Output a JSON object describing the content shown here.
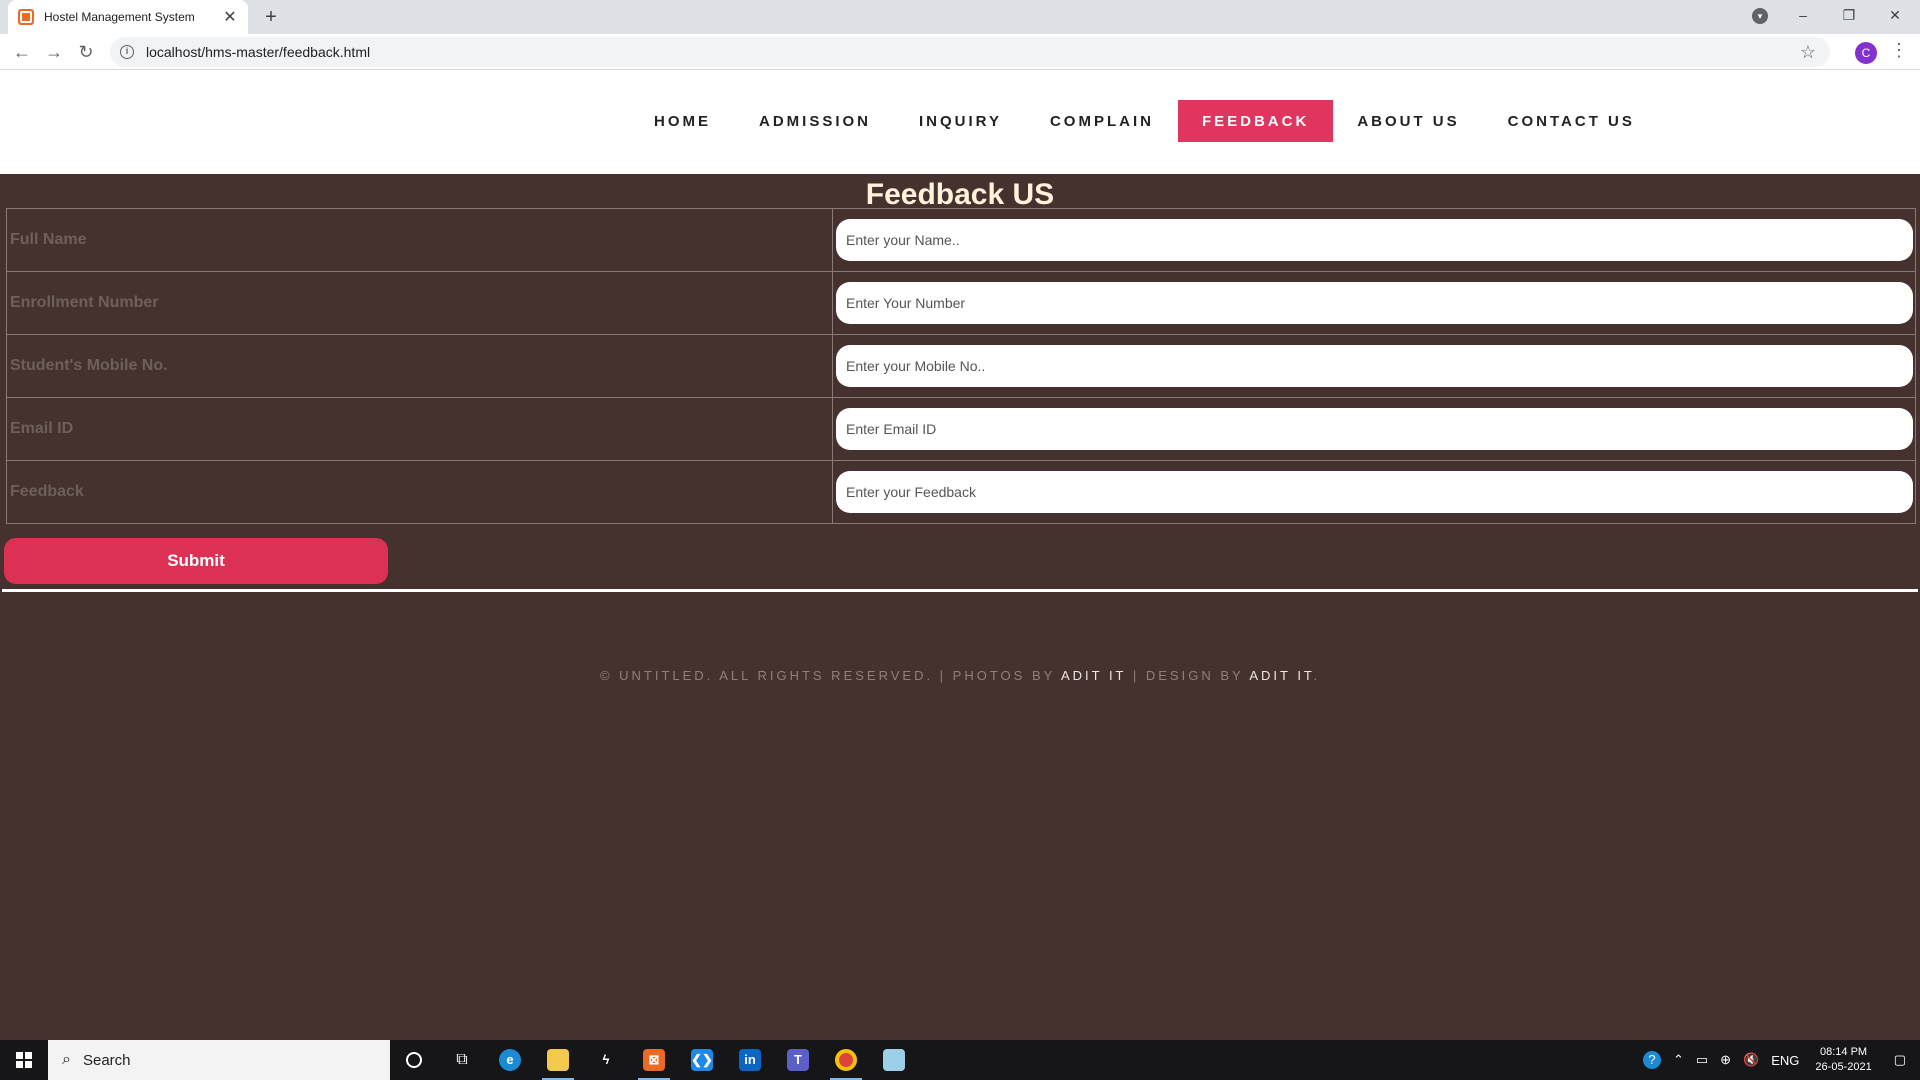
{
  "browser": {
    "tab_title": "Hostel Management System",
    "tab_close": "✕",
    "new_tab": "+",
    "url": "localhost/hms-master/feedback.html",
    "profile_initial": "C"
  },
  "nav": {
    "items": [
      {
        "label": "HOME"
      },
      {
        "label": "ADMISSION"
      },
      {
        "label": "INQUIRY"
      },
      {
        "label": "COMPLAIN"
      },
      {
        "label": "FEEDBACK"
      },
      {
        "label": "ABOUT US"
      },
      {
        "label": "CONTACT US"
      }
    ],
    "active": "FEEDBACK"
  },
  "form": {
    "title": "Feedback US",
    "fields": [
      {
        "label": "Full Name",
        "placeholder": "Enter your Name..",
        "value": ""
      },
      {
        "label": "Enrollment Number",
        "placeholder": "Enter Your Number",
        "value": ""
      },
      {
        "label": "Student's Mobile No.",
        "placeholder": "Enter your Mobile No..",
        "value": ""
      },
      {
        "label": "Email ID",
        "placeholder": "Enter Email ID",
        "value": ""
      },
      {
        "label": "Feedback",
        "placeholder": "Enter your Feedback",
        "value": ""
      }
    ],
    "submit_label": "Submit"
  },
  "footer": {
    "copyright": "© UNTITLED. ALL RIGHTS RESERVED. | PHOTOS BY ",
    "photos_link": "ADIT IT",
    "design_text": " | DESIGN BY ",
    "design_link": "ADIT IT",
    "end": "."
  },
  "taskbar": {
    "search_placeholder": "Search",
    "language": "ENG",
    "time": "08:14 PM",
    "date": "26-05-2021"
  },
  "colors": {
    "page_background": "#45322e",
    "accent": "#e0355e",
    "title_text": "#fff3dc"
  }
}
